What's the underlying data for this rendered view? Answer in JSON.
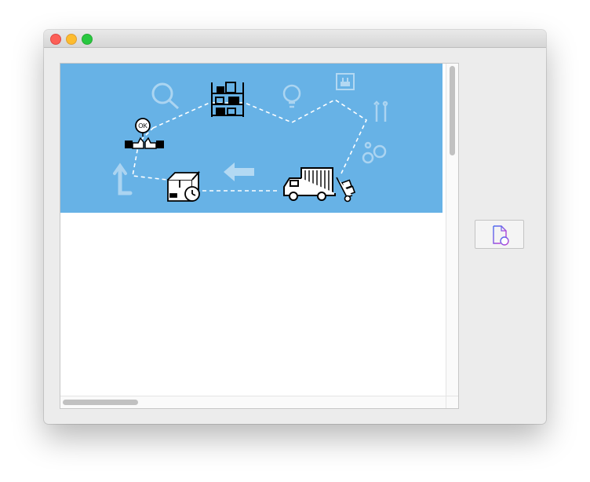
{
  "window": {
    "title": "",
    "controls": [
      "close",
      "minimize",
      "zoom"
    ]
  },
  "content": {
    "banner_illustration": "logistics-process-illustration",
    "banner_color": "#67b2e6",
    "icons": [
      "search-icon",
      "warehouse-shelf-icon",
      "lightbulb-icon",
      "power-plug-icon",
      "tools-icon",
      "gears-icon",
      "thumbs-ok-handshake-icon",
      "package-clock-icon",
      "arrow-left-icon",
      "delivery-truck-icon",
      "hand-truck-icon",
      "turn-arrow-icon"
    ],
    "ok_badge_text": "OK"
  },
  "sidebar": {
    "doc_button_icon": "document-add-icon",
    "doc_button_accent": "#a24bdc"
  }
}
